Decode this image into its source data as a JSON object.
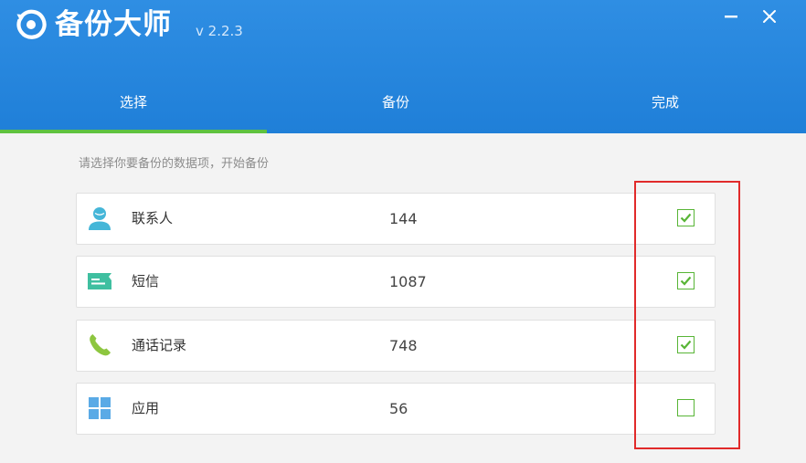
{
  "app": {
    "title": "备份大师",
    "version": "v 2.2.3"
  },
  "window_controls": {
    "minimize_icon": "minimize-icon",
    "close_icon": "close-icon"
  },
  "tabs": [
    {
      "label": "选择",
      "active": true
    },
    {
      "label": "备份",
      "active": false
    },
    {
      "label": "完成",
      "active": false
    }
  ],
  "instruction": "请选择你要备份的数据项，开始备份",
  "items": [
    {
      "label": "联系人",
      "count": "144",
      "checked": true,
      "icon": "contact-person-icon"
    },
    {
      "label": "短信",
      "count": "1087",
      "checked": true,
      "icon": "message-icon"
    },
    {
      "label": "通话记录",
      "count": "748",
      "checked": true,
      "icon": "phone-icon"
    },
    {
      "label": "应用",
      "count": "56",
      "checked": false,
      "icon": "apps-grid-icon"
    }
  ],
  "colors": {
    "header": "#2b8be0",
    "tab_indicator": "#5fc23f",
    "checkbox": "#58b536",
    "highlight": "#e12a2a",
    "contact_icon": "#45b6d8",
    "message_icon": "#3fbfa0",
    "phone_icon": "#8dc63f",
    "apps_icon": "#5aaae6"
  }
}
